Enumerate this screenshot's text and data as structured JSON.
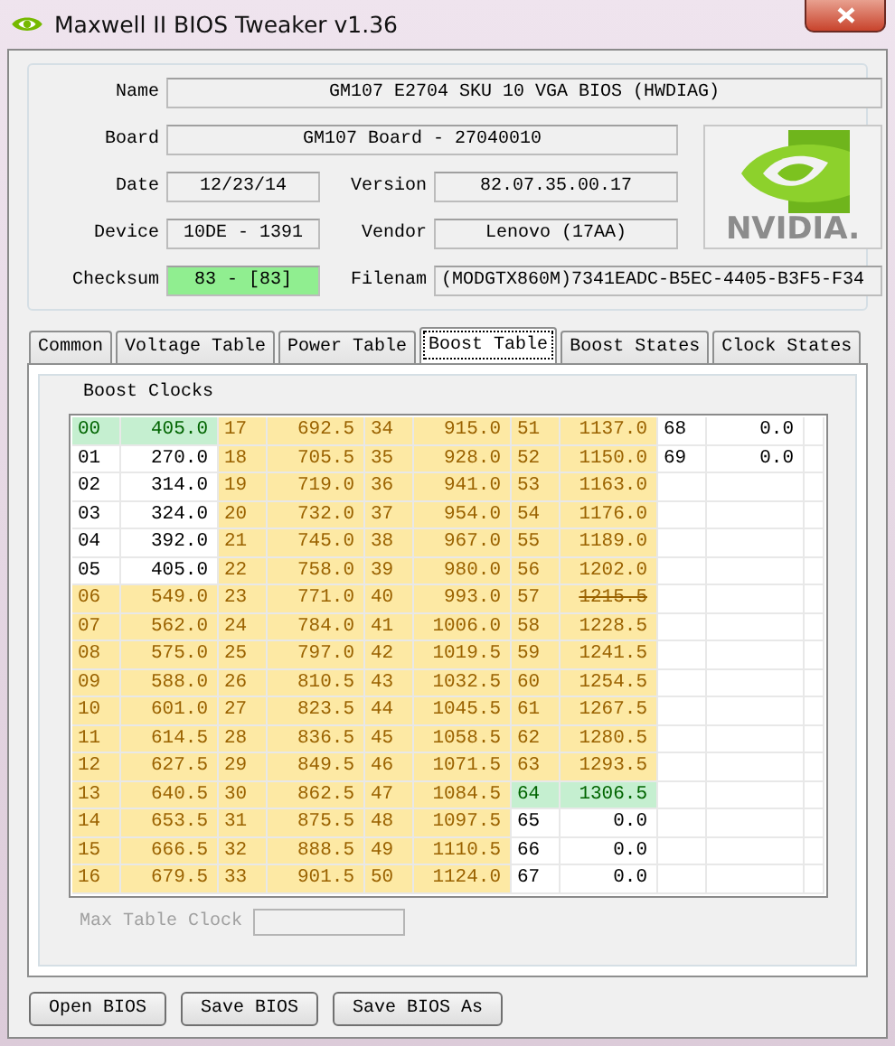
{
  "window": {
    "title": "Maxwell II BIOS Tweaker v1.36"
  },
  "info": {
    "name": {
      "label": "Name",
      "value": "GM107 E2704 SKU 10 VGA BIOS (HWDIAG)"
    },
    "board": {
      "label": "Board",
      "value": "GM107 Board - 27040010"
    },
    "date": {
      "label": "Date",
      "value": "12/23/14"
    },
    "version": {
      "label": "Version",
      "value": "82.07.35.00.17"
    },
    "device": {
      "label": "Device",
      "value": "10DE - 1391"
    },
    "vendor": {
      "label": "Vendor",
      "value": "Lenovo (17AA)"
    },
    "checksum": {
      "label": "Checksum",
      "value": "83 - [83]",
      "valid": true
    },
    "filename": {
      "label": "Filenam",
      "value": "(MODGTX860M)7341EADC-B5EC-4405-B3F5-F34"
    }
  },
  "logo": {
    "wordmark": "NVIDIA."
  },
  "tabs": [
    {
      "label": "Common",
      "selected": false
    },
    {
      "label": "Voltage Table",
      "selected": false
    },
    {
      "label": "Power Table",
      "selected": false
    },
    {
      "label": "Boost Table",
      "selected": true
    },
    {
      "label": "Boost States",
      "selected": false
    },
    {
      "label": "Clock States",
      "selected": false
    }
  ],
  "boost": {
    "title": "Boost Clocks",
    "columns": [
      [
        {
          "index": "00",
          "clock": "405.0",
          "kind": "current",
          "struck": false
        },
        {
          "index": "01",
          "clock": "270.0",
          "kind": "unused",
          "struck": false
        },
        {
          "index": "02",
          "clock": "314.0",
          "kind": "unused",
          "struck": false
        },
        {
          "index": "03",
          "clock": "324.0",
          "kind": "unused",
          "struck": false
        },
        {
          "index": "04",
          "clock": "392.0",
          "kind": "unused",
          "struck": false
        },
        {
          "index": "05",
          "clock": "405.0",
          "kind": "unused",
          "struck": false
        },
        {
          "index": "06",
          "clock": "549.0",
          "kind": "boost",
          "struck": false
        },
        {
          "index": "07",
          "clock": "562.0",
          "kind": "boost",
          "struck": false
        },
        {
          "index": "08",
          "clock": "575.0",
          "kind": "boost",
          "struck": false
        },
        {
          "index": "09",
          "clock": "588.0",
          "kind": "boost",
          "struck": false
        },
        {
          "index": "10",
          "clock": "601.0",
          "kind": "boost",
          "struck": false
        },
        {
          "index": "11",
          "clock": "614.5",
          "kind": "boost",
          "struck": false
        },
        {
          "index": "12",
          "clock": "627.5",
          "kind": "boost",
          "struck": false
        },
        {
          "index": "13",
          "clock": "640.5",
          "kind": "boost",
          "struck": false
        },
        {
          "index": "14",
          "clock": "653.5",
          "kind": "boost",
          "struck": false
        },
        {
          "index": "15",
          "clock": "666.5",
          "kind": "boost",
          "struck": false
        },
        {
          "index": "16",
          "clock": "679.5",
          "kind": "boost",
          "struck": false
        }
      ],
      [
        {
          "index": "17",
          "clock": "692.5",
          "kind": "boost",
          "struck": false
        },
        {
          "index": "18",
          "clock": "705.5",
          "kind": "boost",
          "struck": false
        },
        {
          "index": "19",
          "clock": "719.0",
          "kind": "boost",
          "struck": false
        },
        {
          "index": "20",
          "clock": "732.0",
          "kind": "boost",
          "struck": false
        },
        {
          "index": "21",
          "clock": "745.0",
          "kind": "boost",
          "struck": false
        },
        {
          "index": "22",
          "clock": "758.0",
          "kind": "boost",
          "struck": false
        },
        {
          "index": "23",
          "clock": "771.0",
          "kind": "boost",
          "struck": false
        },
        {
          "index": "24",
          "clock": "784.0",
          "kind": "boost",
          "struck": false
        },
        {
          "index": "25",
          "clock": "797.0",
          "kind": "boost",
          "struck": false
        },
        {
          "index": "26",
          "clock": "810.5",
          "kind": "boost",
          "struck": false
        },
        {
          "index": "27",
          "clock": "823.5",
          "kind": "boost",
          "struck": false
        },
        {
          "index": "28",
          "clock": "836.5",
          "kind": "boost",
          "struck": false
        },
        {
          "index": "29",
          "clock": "849.5",
          "kind": "boost",
          "struck": false
        },
        {
          "index": "30",
          "clock": "862.5",
          "kind": "boost",
          "struck": false
        },
        {
          "index": "31",
          "clock": "875.5",
          "kind": "boost",
          "struck": false
        },
        {
          "index": "32",
          "clock": "888.5",
          "kind": "boost",
          "struck": false
        },
        {
          "index": "33",
          "clock": "901.5",
          "kind": "boost",
          "struck": false
        }
      ],
      [
        {
          "index": "34",
          "clock": "915.0",
          "kind": "boost",
          "struck": false
        },
        {
          "index": "35",
          "clock": "928.0",
          "kind": "boost",
          "struck": false
        },
        {
          "index": "36",
          "clock": "941.0",
          "kind": "boost",
          "struck": false
        },
        {
          "index": "37",
          "clock": "954.0",
          "kind": "boost",
          "struck": false
        },
        {
          "index": "38",
          "clock": "967.0",
          "kind": "boost",
          "struck": false
        },
        {
          "index": "39",
          "clock": "980.0",
          "kind": "boost",
          "struck": false
        },
        {
          "index": "40",
          "clock": "993.0",
          "kind": "boost",
          "struck": false
        },
        {
          "index": "41",
          "clock": "1006.0",
          "kind": "boost",
          "struck": false
        },
        {
          "index": "42",
          "clock": "1019.5",
          "kind": "boost",
          "struck": false
        },
        {
          "index": "43",
          "clock": "1032.5",
          "kind": "boost",
          "struck": false
        },
        {
          "index": "44",
          "clock": "1045.5",
          "kind": "boost",
          "struck": false
        },
        {
          "index": "45",
          "clock": "1058.5",
          "kind": "boost",
          "struck": false
        },
        {
          "index": "46",
          "clock": "1071.5",
          "kind": "boost",
          "struck": false
        },
        {
          "index": "47",
          "clock": "1084.5",
          "kind": "boost",
          "struck": false
        },
        {
          "index": "48",
          "clock": "1097.5",
          "kind": "boost",
          "struck": false
        },
        {
          "index": "49",
          "clock": "1110.5",
          "kind": "boost",
          "struck": false
        },
        {
          "index": "50",
          "clock": "1124.0",
          "kind": "boost",
          "struck": false
        }
      ],
      [
        {
          "index": "51",
          "clock": "1137.0",
          "kind": "boost",
          "struck": false
        },
        {
          "index": "52",
          "clock": "1150.0",
          "kind": "boost",
          "struck": false
        },
        {
          "index": "53",
          "clock": "1163.0",
          "kind": "boost",
          "struck": false
        },
        {
          "index": "54",
          "clock": "1176.0",
          "kind": "boost",
          "struck": false
        },
        {
          "index": "55",
          "clock": "1189.0",
          "kind": "boost",
          "struck": false
        },
        {
          "index": "56",
          "clock": "1202.0",
          "kind": "boost",
          "struck": false
        },
        {
          "index": "57",
          "clock": "1215.5",
          "kind": "boost",
          "struck": true
        },
        {
          "index": "58",
          "clock": "1228.5",
          "kind": "boost",
          "struck": false
        },
        {
          "index": "59",
          "clock": "1241.5",
          "kind": "boost",
          "struck": false
        },
        {
          "index": "60",
          "clock": "1254.5",
          "kind": "boost",
          "struck": false
        },
        {
          "index": "61",
          "clock": "1267.5",
          "kind": "boost",
          "struck": false
        },
        {
          "index": "62",
          "clock": "1280.5",
          "kind": "boost",
          "struck": false
        },
        {
          "index": "63",
          "clock": "1293.5",
          "kind": "boost",
          "struck": false
        },
        {
          "index": "64",
          "clock": "1306.5",
          "kind": "current",
          "struck": false
        },
        {
          "index": "65",
          "clock": "0.0",
          "kind": "unused",
          "struck": false
        },
        {
          "index": "66",
          "clock": "0.0",
          "kind": "unused",
          "struck": false
        },
        {
          "index": "67",
          "clock": "0.0",
          "kind": "unused",
          "struck": false
        }
      ],
      [
        {
          "index": "68",
          "clock": "0.0",
          "kind": "unused",
          "struck": false
        },
        {
          "index": "69",
          "clock": "0.0",
          "kind": "unused",
          "struck": false
        }
      ]
    ]
  },
  "max_clock": {
    "label": "Max Table Clock",
    "disabled": true
  },
  "buttons": [
    "Open BIOS",
    "Save BIOS",
    "Save BIOS As"
  ]
}
